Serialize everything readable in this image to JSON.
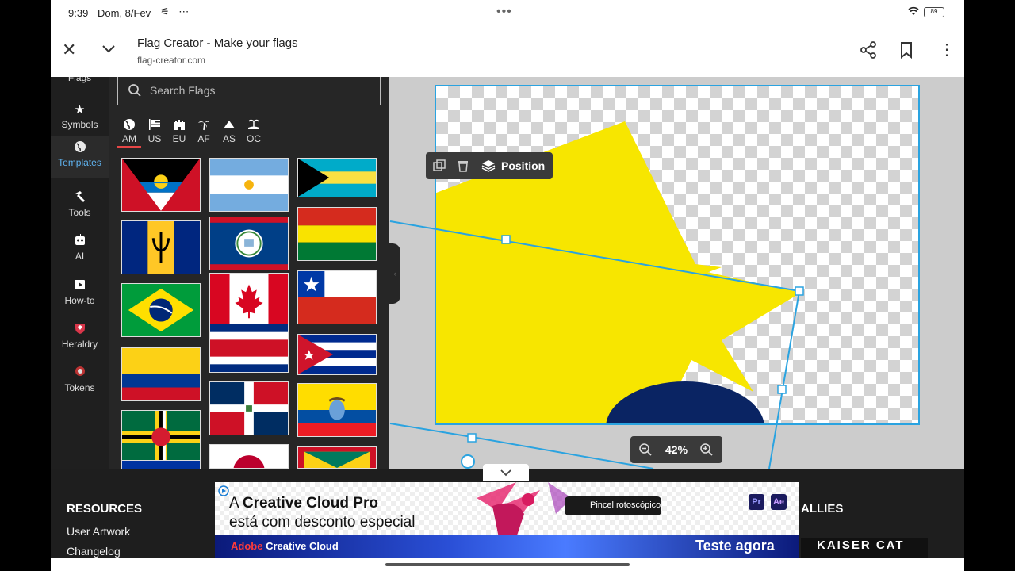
{
  "status_bar": {
    "time": "9:39",
    "date": "Dom, 8/Fev",
    "battery": "89"
  },
  "browser": {
    "title": "Flag Creator - Make your flags",
    "url": "flag-creator.com"
  },
  "nav": {
    "top_label": "Flags",
    "items": [
      {
        "label": "Symbols",
        "icon": "star-icon"
      },
      {
        "label": "Templates",
        "icon": "globe-icon"
      },
      {
        "label": "Tools",
        "icon": "hammer-icon"
      },
      {
        "label": "AI",
        "icon": "robot-icon"
      },
      {
        "label": "How-to",
        "icon": "video-icon"
      },
      {
        "label": "Heraldry",
        "icon": "shield-icon"
      },
      {
        "label": "Tokens",
        "icon": "token-icon"
      }
    ]
  },
  "search": {
    "placeholder": "Search Flags"
  },
  "regions": [
    "AM",
    "US",
    "EU",
    "AF",
    "AS",
    "OC"
  ],
  "flags": [
    "Antigua and Barbuda",
    "Argentina",
    "Bahamas",
    "Barbados",
    "Belize",
    "Bolivia",
    "Brazil",
    "Canada",
    "Chile",
    "Colombia",
    "Costa Rica",
    "Cuba",
    "Dominica",
    "Dominican Republic",
    "Ecuador",
    "Ecuador",
    "Grenada"
  ],
  "toolbar": {
    "position_label": "Position"
  },
  "zoom": {
    "value": "42%"
  },
  "footer": {
    "resources": "RESOURCES",
    "user_artwork": "User Artwork",
    "changelog": "Changelog",
    "allies": "ALLIES",
    "kaiser": "KAISER CAT"
  },
  "ad": {
    "line1_prefix": "A ",
    "line1_bold": "Creative Cloud Pro",
    "line2": "está com desconto especial",
    "brand_adobe": "Adobe",
    "brand_cc": " Creative Cloud",
    "cta": "Teste agora",
    "pill": "Pincel rotoscópico",
    "pr": "Pr",
    "ae": "Ae"
  },
  "colors": {
    "accent": "#2aa3e0",
    "star_yellow": "#f7e600",
    "navy": "#0a2463",
    "panel": "#262626"
  }
}
